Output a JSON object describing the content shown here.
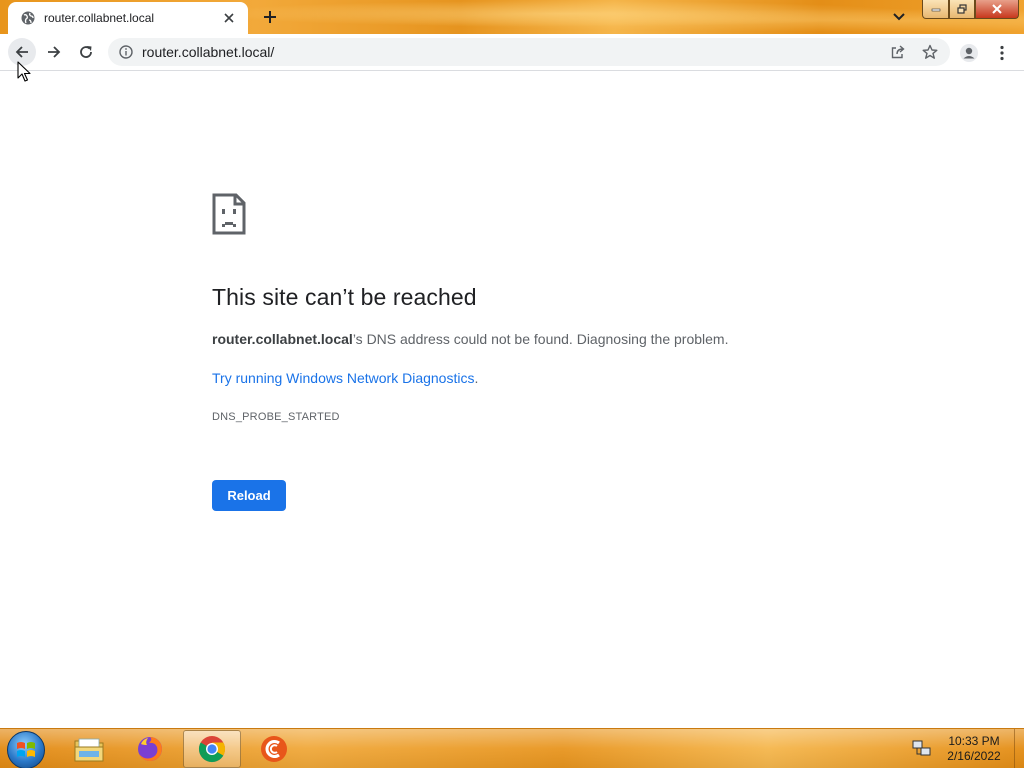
{
  "browser": {
    "tab": {
      "title": "router.collabnet.local",
      "favicon": "globe-icon",
      "close_icon": "close-icon"
    },
    "new_tab_icon": "plus-icon",
    "tab_search_icon": "chevron-down-icon",
    "address_bar": {
      "url": "router.collabnet.local/",
      "info_icon": "info-icon"
    },
    "toolbar_icons": [
      "back-arrow-icon",
      "forward-arrow-icon",
      "reload-icon",
      "share-icon",
      "star-icon",
      "profile-icon",
      "more-vert-icon"
    ]
  },
  "error_page": {
    "title": "This site can’t be reached",
    "host": "router.collabnet.local",
    "description_rest": "’s DNS address could not be found. Diagnosing the problem.",
    "link_text": "Try running Windows Network Diagnostics",
    "link_suffix": ".",
    "error_code": "DNS_PROBE_STARTED",
    "reload_label": "Reload"
  },
  "taskbar": {
    "apps": [
      "windows-explorer-icon",
      "firefox-icon",
      "chrome-icon",
      "ccleaner-icon"
    ],
    "active_app": "chrome-icon",
    "clock_time": "10:33 PM",
    "clock_date": "2/16/2022"
  },
  "colors": {
    "link": "#1a73e8",
    "button": "#1a73e8",
    "title_text": "#202124",
    "body_text": "#5f6368",
    "theme_orange": "#e8951c"
  }
}
